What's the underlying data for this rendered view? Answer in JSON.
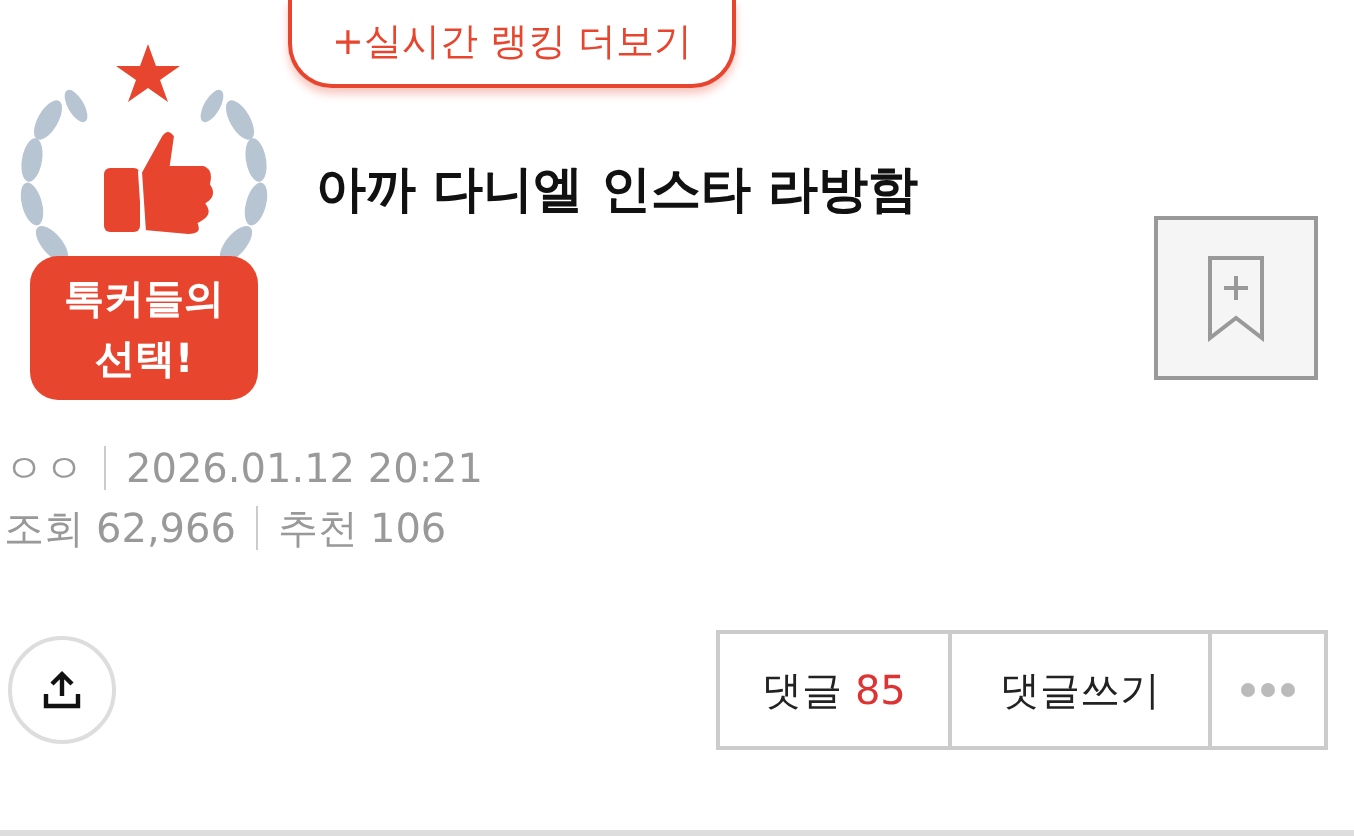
{
  "badge": {
    "lines": [
      "톡커들의",
      "선택!"
    ]
  },
  "ranking_button": {
    "label": "+실시간 랭킹 더보기"
  },
  "post": {
    "title": "아까 다니엘 인스타 라방함",
    "author": "ㅇㅇ",
    "datetime": "2026.01.12 20:21",
    "views_label": "조회",
    "views": "62,966",
    "likes_label": "추천",
    "likes": "106"
  },
  "actions": {
    "comments_label": "댓글",
    "comments_count": "85",
    "write_comment": "댓글쓰기"
  }
}
